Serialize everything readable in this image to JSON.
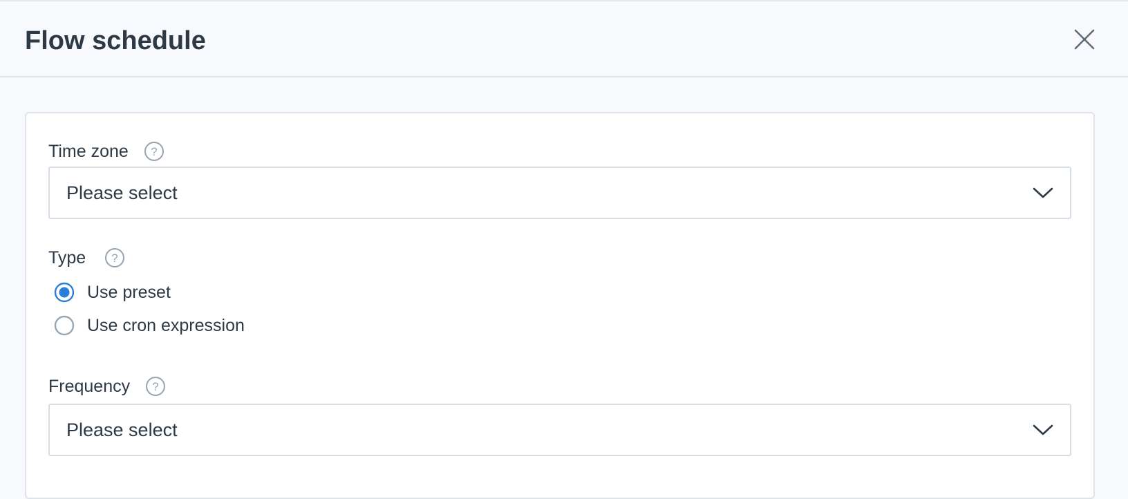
{
  "dialog": {
    "title": "Flow schedule",
    "close_icon": "close-icon"
  },
  "form": {
    "time_zone": {
      "label": "Time zone",
      "help_icon": "help-circle-icon",
      "value": "Please select"
    },
    "type": {
      "label": "Type",
      "help_icon": "help-circle-icon",
      "options": [
        {
          "label": "Use preset",
          "selected": true
        },
        {
          "label": "Use cron expression",
          "selected": false
        }
      ]
    },
    "frequency": {
      "label": "Frequency",
      "help_icon": "help-circle-icon",
      "value": "Please select"
    }
  },
  "colors": {
    "accent": "#2b7fd6",
    "text": "#2d3a46",
    "border": "#d6dde5",
    "background": "#f7f9fc"
  }
}
